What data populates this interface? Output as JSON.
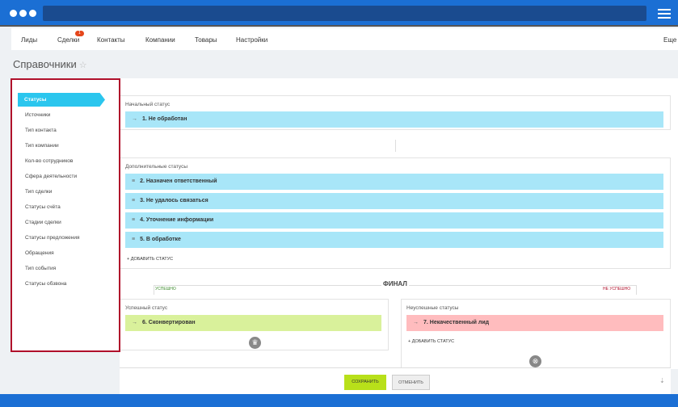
{
  "nav": {
    "items": [
      "Лиды",
      "Сделки",
      "Контакты",
      "Компании",
      "Товары",
      "Настройки"
    ],
    "more": "Еще",
    "deals_badge": "1"
  },
  "page": {
    "title": "Справочники"
  },
  "sidebar": {
    "active": "Статусы",
    "items": [
      "Источники",
      "Тип контакта",
      "Тип компании",
      "Кол-во сотрудников",
      "Сфера деятельности",
      "Тип сделки",
      "Статусы счёта",
      "Стадии сделки",
      "Статусы предложения",
      "Обращения",
      "Тип события",
      "Статусы обзвона"
    ]
  },
  "initial": {
    "label": "Начальный статус",
    "status": "1. Не обработан"
  },
  "extra": {
    "label": "Дополнительные статусы",
    "statuses": [
      "2. Назначен ответственный",
      "3. Не удалось связаться",
      "4. Уточнение информации",
      "5. В обработке"
    ],
    "add": "+ ДОБАВИТЬ СТАТУС"
  },
  "final": {
    "title": "ФИНАЛ",
    "success_tab": "УСПЕШНО",
    "fail_tab": "НЕ УСПЕШНО",
    "success_label": "Успешный статус",
    "success_status": "6. Сконвертирован",
    "fail_label": "Неуспешные статусы",
    "fail_status": "7. Некачественный лид",
    "add": "+ ДОБАВИТЬ СТАТУС"
  },
  "footer": {
    "save": "СОХРАНИТЬ",
    "cancel": "ОТМЕНИТЬ"
  },
  "colors": {
    "accent": "#2bc6ee",
    "status": "#a8e6f8",
    "success": "#d9f19b",
    "fail": "#ffbcbe",
    "save": "#b8e01a",
    "topbar": "#1b6fd4",
    "highlight": "#b0102b"
  }
}
